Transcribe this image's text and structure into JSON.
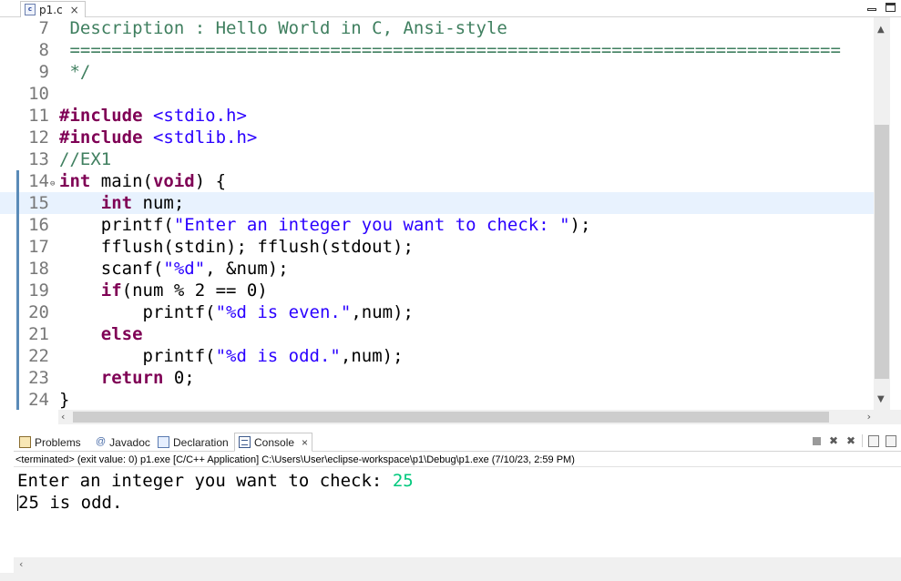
{
  "editor_tab": {
    "file_name": "p1.c",
    "icon": "c-file-icon",
    "close": "×"
  },
  "code_lines": [
    {
      "num": "7",
      "segments": [
        {
          "t": " Description : Hello World in C, Ansi-style",
          "c": "cm"
        }
      ]
    },
    {
      "num": "8",
      "segments": [
        {
          "t": " ==========================================================================",
          "c": "cm"
        }
      ]
    },
    {
      "num": "9",
      "segments": [
        {
          "t": " */",
          "c": "cm"
        }
      ]
    },
    {
      "num": "10",
      "segments": []
    },
    {
      "num": "11",
      "segments": [
        {
          "t": "#include ",
          "c": "pp"
        },
        {
          "t": "<stdio.h>",
          "c": "inc"
        }
      ]
    },
    {
      "num": "12",
      "segments": [
        {
          "t": "#include ",
          "c": "pp"
        },
        {
          "t": "<stdlib.h>",
          "c": "inc"
        }
      ]
    },
    {
      "num": "13",
      "segments": [
        {
          "t": "//EX1",
          "c": "cm"
        }
      ]
    },
    {
      "num": "14",
      "fold": true,
      "segments": [
        {
          "t": "int",
          "c": "kw"
        },
        {
          "t": " main("
        },
        {
          "t": "void",
          "c": "kw"
        },
        {
          "t": ") {"
        }
      ]
    },
    {
      "num": "15",
      "current": true,
      "segments": [
        {
          "t": "    "
        },
        {
          "t": "int",
          "c": "kw"
        },
        {
          "t": " num;"
        }
      ]
    },
    {
      "num": "16",
      "segments": [
        {
          "t": "    printf("
        },
        {
          "t": "\"Enter an integer you want to check: \"",
          "c": "str"
        },
        {
          "t": ");"
        }
      ]
    },
    {
      "num": "17",
      "segments": [
        {
          "t": "    fflush(stdin); fflush(stdout);"
        }
      ]
    },
    {
      "num": "18",
      "segments": [
        {
          "t": "    scanf("
        },
        {
          "t": "\"%d\"",
          "c": "str"
        },
        {
          "t": ", &num);"
        }
      ]
    },
    {
      "num": "19",
      "segments": [
        {
          "t": "    "
        },
        {
          "t": "if",
          "c": "kw"
        },
        {
          "t": "(num % 2 == 0)"
        }
      ]
    },
    {
      "num": "20",
      "segments": [
        {
          "t": "        printf("
        },
        {
          "t": "\"%d is even.\"",
          "c": "str"
        },
        {
          "t": ",num);"
        }
      ]
    },
    {
      "num": "21",
      "segments": [
        {
          "t": "    "
        },
        {
          "t": "else",
          "c": "kw"
        }
      ]
    },
    {
      "num": "22",
      "segments": [
        {
          "t": "        printf("
        },
        {
          "t": "\"%d is odd.\"",
          "c": "str"
        },
        {
          "t": ",num);"
        }
      ]
    },
    {
      "num": "23",
      "segments": [
        {
          "t": "    "
        },
        {
          "t": "return",
          "c": "kw"
        },
        {
          "t": " 0;"
        }
      ]
    },
    {
      "num": "24",
      "segments": [
        {
          "t": "}"
        }
      ]
    }
  ],
  "views": {
    "tabs": [
      {
        "label": "Problems",
        "icon": "problems-icon"
      },
      {
        "label": "Javadoc",
        "icon": "javadoc-icon",
        "glyph": "@"
      },
      {
        "label": "Declaration",
        "icon": "declaration-icon"
      },
      {
        "label": "Console",
        "icon": "console-icon",
        "active": true,
        "close": "×"
      }
    ]
  },
  "console": {
    "status": "<terminated> (exit value: 0) p1.exe [C/C++ Application] C:\\Users\\User\\eclipse-workspace\\p1\\Debug\\p1.exe (7/10/23, 2:59 PM)",
    "prompt": "Enter an integer you want to check: ",
    "user_input": "25",
    "result": "25 is odd."
  },
  "colors": {
    "comment": "#3f7f5f",
    "keyword": "#7f0055",
    "string": "#2a00ff",
    "user_input": "#00c87d",
    "current_line": "#e8f2fe"
  }
}
